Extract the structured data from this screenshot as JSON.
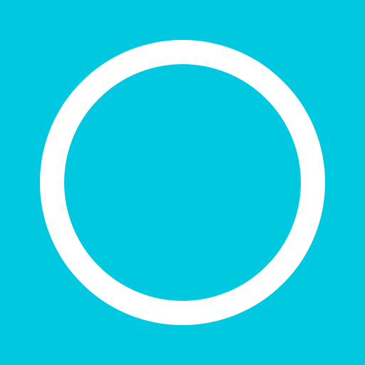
{
  "icon": {
    "name": "ring-icon",
    "shape": "circle-outline"
  },
  "colors": {
    "background": "#00c8e0",
    "ring": "#ffffff"
  }
}
